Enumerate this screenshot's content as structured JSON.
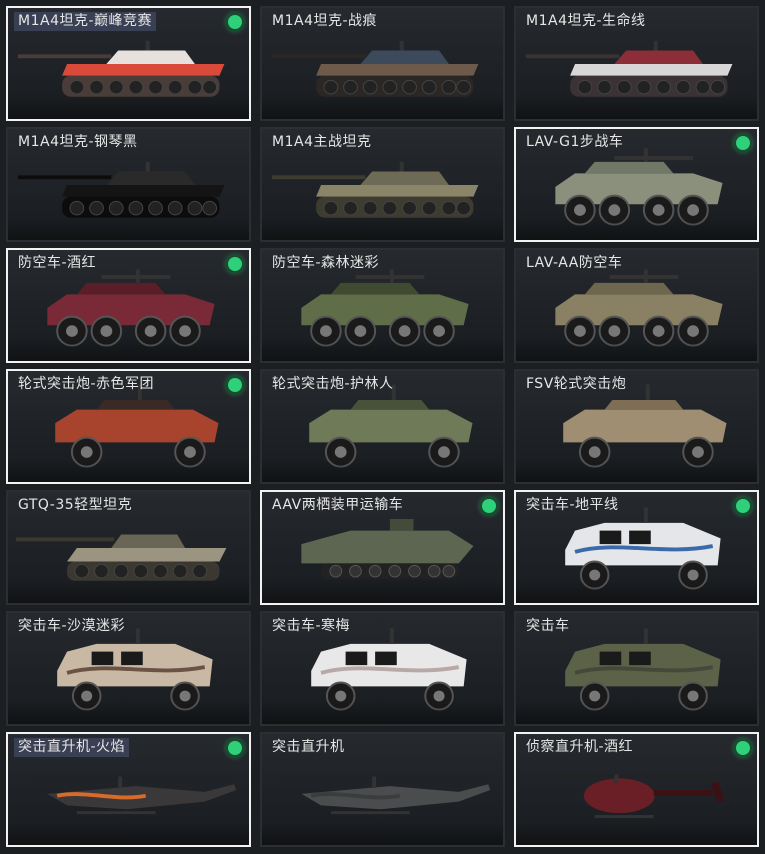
{
  "items": [
    {
      "label": "M1A4坦克-巅峰竞赛",
      "selected": true,
      "badge": true,
      "hl": true,
      "kind": "tank",
      "c1": "#d94a3b",
      "c2": "#e6e1dd",
      "c3": "#4a3c38"
    },
    {
      "label": "M1A4坦克-战痕",
      "selected": false,
      "badge": false,
      "hl": false,
      "kind": "tank",
      "c1": "#6d5a4b",
      "c2": "#3d4a5c",
      "c3": "#2b2724"
    },
    {
      "label": "M1A4坦克-生命线",
      "selected": false,
      "badge": false,
      "hl": false,
      "kind": "tank",
      "c1": "#d8d6d6",
      "c2": "#8c2e38",
      "c3": "#3a3234"
    },
    {
      "label": "M1A4坦克-钢琴黑",
      "selected": false,
      "badge": false,
      "hl": false,
      "kind": "tank",
      "c1": "#141414",
      "c2": "#2a2a2a",
      "c3": "#0c0c0c"
    },
    {
      "label": "M1A4主战坦克",
      "selected": false,
      "badge": false,
      "hl": false,
      "kind": "tank",
      "c1": "#8a8468",
      "c2": "#6d6a55",
      "c3": "#3e3b30"
    },
    {
      "label": "LAV-G1步战车",
      "selected": true,
      "badge": true,
      "hl": false,
      "kind": "apc",
      "c1": "#8a907c",
      "c2": "#727868",
      "c3": "#2a2a2a"
    },
    {
      "label": "防空车-酒红",
      "selected": true,
      "badge": true,
      "hl": false,
      "kind": "aa",
      "c1": "#7a2a36",
      "c2": "#5a1e28",
      "c3": "#2a2a2a"
    },
    {
      "label": "防空车-森林迷彩",
      "selected": false,
      "badge": false,
      "hl": false,
      "kind": "aa",
      "c1": "#5f6e48",
      "c2": "#3f4a30",
      "c3": "#2a2a2a"
    },
    {
      "label": "LAV-AA防空车",
      "selected": false,
      "badge": false,
      "hl": false,
      "kind": "aa",
      "c1": "#8a8064",
      "c2": "#6e664e",
      "c3": "#2a2a2a"
    },
    {
      "label": "轮式突击炮-赤色军团",
      "selected": true,
      "badge": true,
      "hl": false,
      "kind": "armored",
      "c1": "#a8432e",
      "c2": "#3a2a26",
      "c3": "#222"
    },
    {
      "label": "轮式突击炮-护林人",
      "selected": false,
      "badge": false,
      "hl": false,
      "kind": "armored",
      "c1": "#6e7a58",
      "c2": "#48523a",
      "c3": "#222"
    },
    {
      "label": "FSV轮式突击炮",
      "selected": false,
      "badge": false,
      "hl": false,
      "kind": "armored",
      "c1": "#a08e72",
      "c2": "#7e6e56",
      "c3": "#222"
    },
    {
      "label": "GTQ-35轻型坦克",
      "selected": false,
      "badge": false,
      "hl": false,
      "kind": "light",
      "c1": "#9a9480",
      "c2": "#6a6656",
      "c3": "#3a3830"
    },
    {
      "label": "AAV两栖装甲运输车",
      "selected": true,
      "badge": true,
      "hl": false,
      "kind": "aav",
      "c1": "#5d6650",
      "c2": "#444b3a",
      "c3": "#2a2a2a"
    },
    {
      "label": "突击车-地平线",
      "selected": true,
      "badge": true,
      "hl": false,
      "kind": "mrap",
      "c1": "#e4e6ea",
      "c2": "#3a6aa8",
      "c3": "#222"
    },
    {
      "label": "突击车-沙漠迷彩",
      "selected": false,
      "badge": false,
      "hl": false,
      "kind": "mrap",
      "c1": "#c9b9a4",
      "c2": "#6a5244",
      "c3": "#222"
    },
    {
      "label": "突击车-寒梅",
      "selected": false,
      "badge": false,
      "hl": false,
      "kind": "mrap",
      "c1": "#e8e8e8",
      "c2": "#b8a8a8",
      "c3": "#222"
    },
    {
      "label": "突击车",
      "selected": false,
      "badge": false,
      "hl": false,
      "kind": "mrap",
      "c1": "#5c6248",
      "c2": "#44493a",
      "c3": "#222"
    },
    {
      "label": "突击直升机-火焰",
      "selected": true,
      "badge": true,
      "hl": true,
      "kind": "heli",
      "c1": "#3a3838",
      "c2": "#d86a2a",
      "c3": "#1a1a1a"
    },
    {
      "label": "突击直升机",
      "selected": false,
      "badge": false,
      "hl": false,
      "kind": "heli",
      "c1": "#4a4c4e",
      "c2": "#3a3c3e",
      "c3": "#1a1a1a"
    },
    {
      "label": "侦察直升机-酒红",
      "selected": true,
      "badge": true,
      "hl": false,
      "kind": "scout",
      "c1": "#6a1e26",
      "c2": "#3a1216",
      "c3": "#1a1a1a"
    }
  ]
}
